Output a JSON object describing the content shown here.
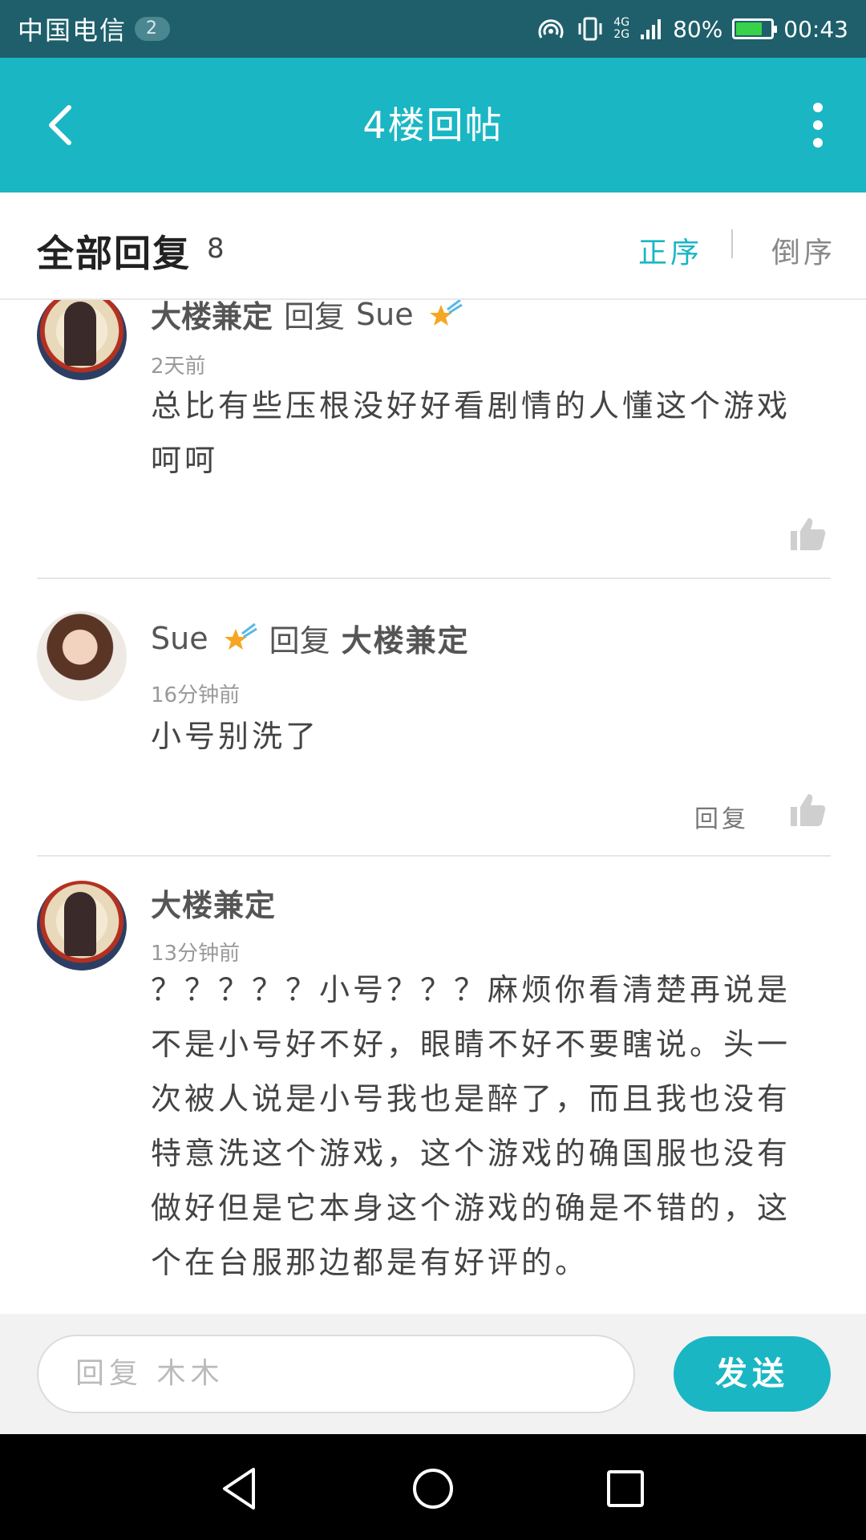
{
  "status_bar": {
    "carrier": "中国电信",
    "sim_badge": "2",
    "network_top": "4G",
    "network_bottom": "2G",
    "battery": "80%",
    "battery_level": 0.8,
    "time": "00:43"
  },
  "app_bar": {
    "title": "4楼回帖"
  },
  "header": {
    "title": "全部回复",
    "count": "8",
    "sort_asc": "正序",
    "sort_desc": "倒序"
  },
  "comments": [
    {
      "user": "大楼兼定",
      "reply_word": "回复",
      "reply_to": "Sue",
      "time": "2天前",
      "content": "总比有些压根没好好看剧情的人懂这个游戏呵呵",
      "avatar": "avatar-girl"
    },
    {
      "user": "Sue",
      "reply_word": "回复",
      "reply_to": "大楼兼定",
      "time": "16分钟前",
      "content": "小号别洗了",
      "reply_action": "回复",
      "avatar": "avatar-sue"
    },
    {
      "user": "大楼兼定",
      "time": "13分钟前",
      "content": "？？？？？小号？？？麻烦你看清楚再说是不是小号好不好，眼睛不好不要瞎说。头一次被人说是小号我也是醉了，而且我也没有特意洗这个游戏，这个游戏的确国服也没有做好但是它本身这个游戏的确是不错的，这个在台服那边都是有好评的。",
      "avatar": "avatar-girl"
    }
  ],
  "input": {
    "placeholder": "回复 木木",
    "send_label": "发送"
  },
  "colors": {
    "accent": "#1ab6c4",
    "status_bar": "#1e5f6b"
  }
}
